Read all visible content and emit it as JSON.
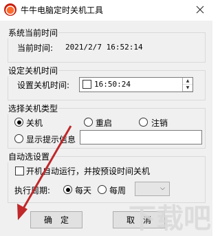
{
  "window": {
    "title": "牛牛电脑定时关机工具"
  },
  "current_time_group": {
    "legend": "系统当前时间",
    "label": "当前时间:",
    "value": "2021/2/7 16:52:14"
  },
  "shutdown_time_group": {
    "legend": "设定关机时间",
    "label": "设置关机时间:",
    "time_value": "16:50:24",
    "checked": false
  },
  "shutdown_type_group": {
    "legend": "选择关机类型",
    "options": [
      "关机",
      "重启",
      "注销"
    ],
    "selected": "关机",
    "show_message_label": "显示提示信息",
    "message_value": ""
  },
  "auto_group": {
    "legend": "自动选设置",
    "autostart_label": "开机自动运行，并按预设时间关机",
    "period_label": "执行周期:",
    "period_options": [
      "每天",
      "每周"
    ],
    "period_selected": "每天",
    "weekday_value": ""
  },
  "buttons": {
    "ok": "确定",
    "cancel": "取消"
  },
  "watermark": "下载吧",
  "colors": {
    "annotation_arrow": "#c0282a"
  }
}
